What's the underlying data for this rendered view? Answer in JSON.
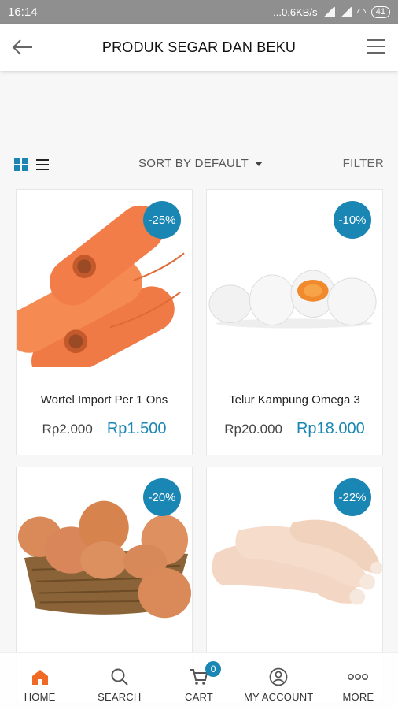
{
  "status_bar": {
    "time": "16:14",
    "network_speed": "...0.6KB/s",
    "battery": "41"
  },
  "header": {
    "title": "PRODUK SEGAR DAN BEKU",
    "back_icon": "arrow-left-icon",
    "menu_icon": "hamburger-menu-icon"
  },
  "toolbar": {
    "sort_label": "SORT BY DEFAULT",
    "filter_label": "FILTER"
  },
  "products": [
    {
      "name": "Wortel Import Per 1 Ons",
      "old_price": "Rp2.000",
      "new_price": "Rp1.500",
      "discount": "-25%",
      "image": "carrots"
    },
    {
      "name": "Telur Kampung Omega 3",
      "old_price": "Rp20.000",
      "new_price": "Rp18.000",
      "discount": "-10%",
      "image": "eggs-white"
    },
    {
      "name": "",
      "old_price": "",
      "new_price": "",
      "discount": "-20%",
      "image": "eggs-basket"
    },
    {
      "name": "",
      "old_price": "",
      "new_price": "",
      "discount": "-22%",
      "image": "chicken-drumsticks"
    }
  ],
  "bottom_nav": {
    "home": "HOME",
    "search": "SEARCH",
    "cart": "CART",
    "cart_count": "0",
    "account": "MY ACCOUNT",
    "more": "MORE"
  },
  "colors": {
    "accent": "#1a86b4",
    "home_active": "#f06a25"
  }
}
